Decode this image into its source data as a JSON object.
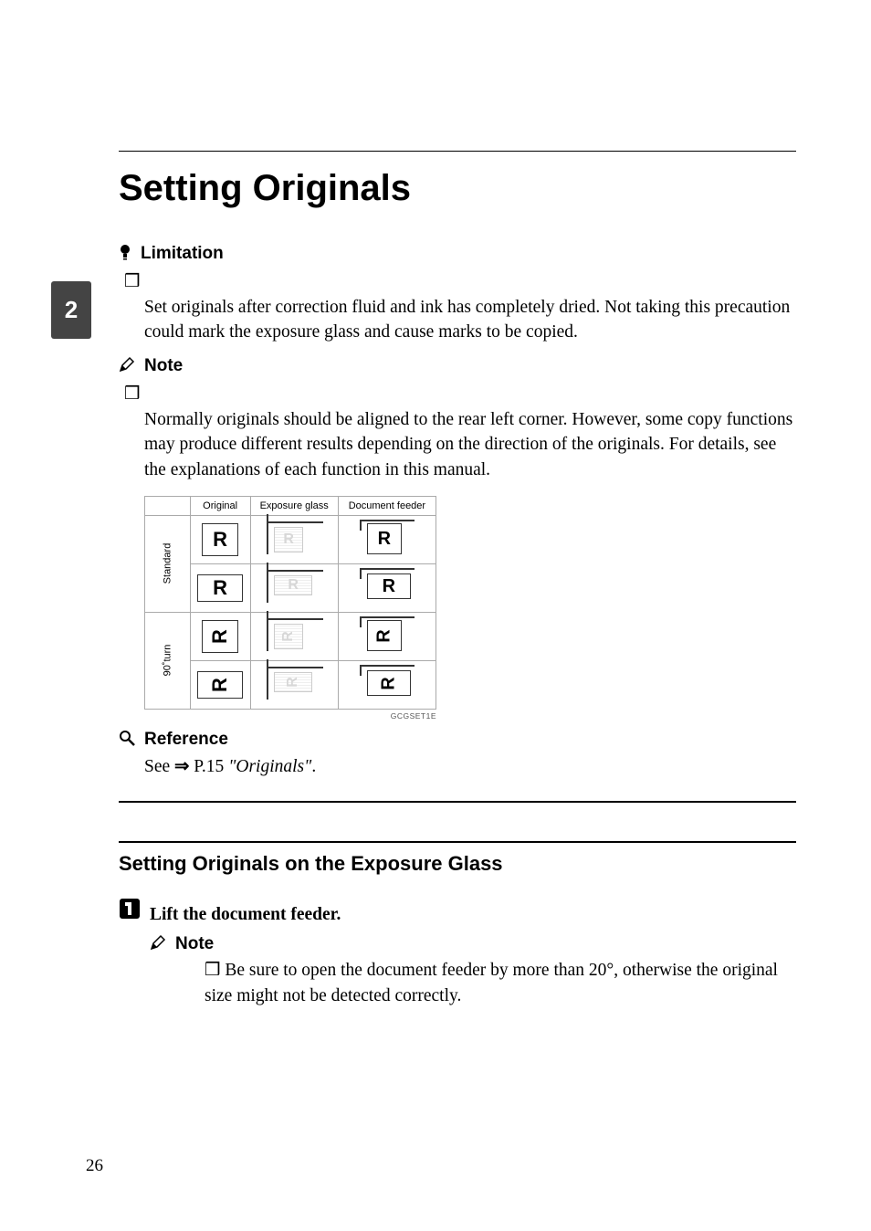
{
  "sideTab": "2",
  "title": "Setting Originals",
  "limitationLabel": "Limitation",
  "limitationBody": "Set originals after correction fluid and ink has completely dried. Not taking this precaution could mark the exposure glass and cause marks to be copied.",
  "noteLabel": "Note",
  "noteBody": "Normally originals should be aligned to the rear left corner. However, some copy functions may produce different results depending on the direction of the originals. For details, see the explanations of each function in this manual.",
  "diagram": {
    "headers": {
      "c1": "Original",
      "c2": "Exposure glass",
      "c3": "Document feeder"
    },
    "rowGroups": {
      "g1": "Standard",
      "g2": "90˚turn"
    },
    "code": "GCGSET1E"
  },
  "referenceLabel": "Reference",
  "reference": {
    "see": "See",
    "arrow": "⇒",
    "page": "P.15",
    "title": "\"Originals\"",
    "period": "."
  },
  "sectionHeading": "Setting Originals on the Exposure Glass",
  "step1": {
    "label": "Lift the document feeder.",
    "noteLabel": "Note",
    "body": "Be sure to open the document feeder by more than 20°, otherwise the original size might not be detected correctly."
  },
  "pageNumber": "26"
}
